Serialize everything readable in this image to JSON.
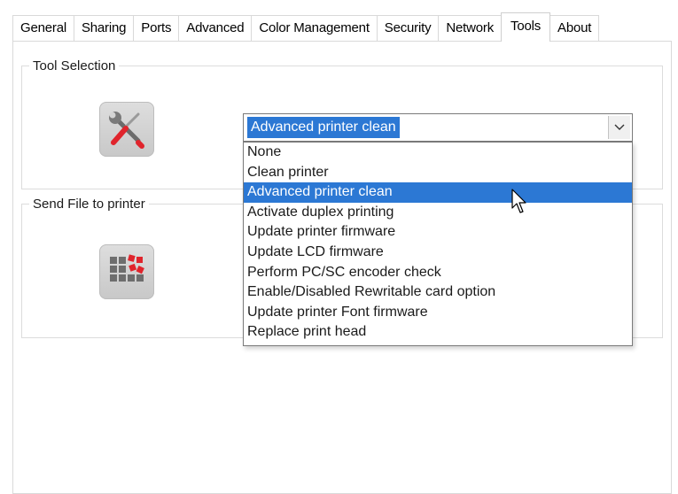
{
  "tabs": [
    {
      "label": "General"
    },
    {
      "label": "Sharing"
    },
    {
      "label": "Ports"
    },
    {
      "label": "Advanced"
    },
    {
      "label": "Color Management"
    },
    {
      "label": "Security"
    },
    {
      "label": "Network"
    },
    {
      "label": "Tools",
      "active": true
    },
    {
      "label": "About"
    }
  ],
  "tool_selection": {
    "legend": "Tool Selection",
    "icon": "tools-icon",
    "combo": {
      "value": "Advanced printer clean",
      "options": [
        "None",
        "Clean printer",
        "Advanced printer clean",
        "Activate duplex printing",
        "Update printer firmware",
        "Update LCD firmware",
        "Perform PC/SC encoder check",
        "Enable/Disabled Rewritable card option",
        "Update printer Font firmware",
        "Replace print head"
      ],
      "selected_index": 2
    }
  },
  "send_file": {
    "legend": "Send File to printer",
    "icon": "send-file-icon"
  },
  "colors": {
    "selection": "#2c78d4",
    "tab_border": "#d9d9d9",
    "icon_red": "#e0242c"
  }
}
